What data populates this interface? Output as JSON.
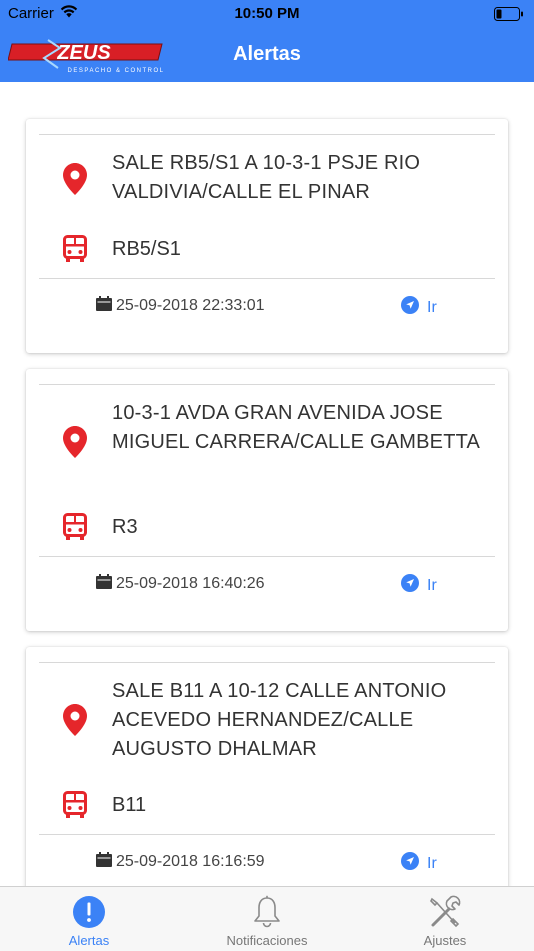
{
  "status_bar": {
    "carrier": "Carrier",
    "time": "10:50 PM"
  },
  "header": {
    "title": "Alertas",
    "logo_text": "ZEUS",
    "logo_subtext": "DESPACHO & CONTROL"
  },
  "alerts": [
    {
      "address": "SALE RB5/S1 A 10-3-1 PSJE RIO VALDIVIA/CALLE EL PINAR",
      "route": "RB5/S1",
      "datetime": "25-09-2018 22:33:01",
      "action_label": "Ir"
    },
    {
      "address": "10-3-1 AVDA GRAN AVENIDA JOSE MIGUEL CARRERA/CALLE GAMBETTA",
      "route": "R3",
      "datetime": "25-09-2018 16:40:26",
      "action_label": "Ir"
    },
    {
      "address": "SALE B11 A 10-12 CALLE ANTONIO ACEVEDO HERNANDEZ/CALLE AUGUSTO DHALMAR",
      "route": "B11",
      "datetime": "25-09-2018 16:16:59",
      "action_label": "Ir"
    }
  ],
  "tabs": [
    {
      "label": "Alertas",
      "icon": "alert-circle-icon",
      "active": true
    },
    {
      "label": "Notificaciones",
      "icon": "bell-icon",
      "active": false
    },
    {
      "label": "Ajustes",
      "icon": "tools-icon",
      "active": false
    }
  ],
  "colors": {
    "brand": "#3b82f6",
    "pin": "#e5262b",
    "bus": "#e5262b",
    "logo_red": "#d81f26"
  }
}
